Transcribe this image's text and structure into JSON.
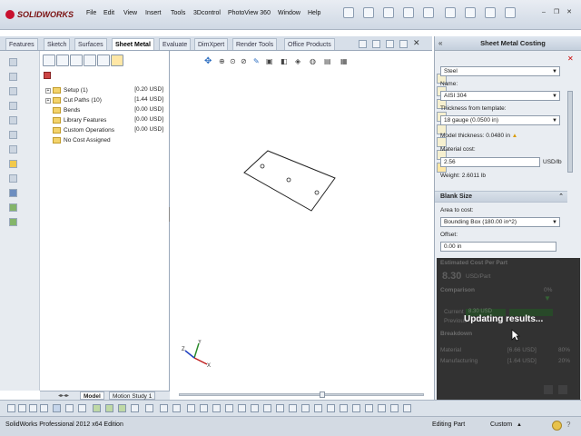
{
  "app": {
    "logo_text": "SOLIDWORKS",
    "menu": [
      "File",
      "Edit",
      "View",
      "Insert",
      "Tools",
      "3Dcontrol",
      "PhotoView 360",
      "Window",
      "Help"
    ]
  },
  "tabs": [
    "Features",
    "Sketch",
    "Surfaces",
    "Sheet Metal",
    "Evaluate",
    "DimXpert",
    "Render Tools",
    "Office Products"
  ],
  "active_tab": "Sheet Metal",
  "feature_tree": [
    {
      "label": "Setup (1)",
      "cost": "[0.20 USD]",
      "expandable": true
    },
    {
      "label": "Cut Paths (10)",
      "cost": "[1.44 USD]",
      "expandable": true
    },
    {
      "label": "Bends",
      "cost": "[0.00 USD]",
      "expandable": false
    },
    {
      "label": "Library Features",
      "cost": "[0.00 USD]",
      "expandable": false
    },
    {
      "label": "Custom Operations",
      "cost": "[0.00 USD]",
      "expandable": false
    },
    {
      "label": "No Cost Assigned",
      "cost": "",
      "expandable": false
    }
  ],
  "model_tabs": [
    "Model",
    "Motion Study 1"
  ],
  "pane": {
    "title": "Sheet Metal Costing",
    "material_class": "Steel",
    "name_label": "Name:",
    "name_value": "AISI 304",
    "thickness_label": "Thickness from template:",
    "thickness_value": "18 gauge (0.0500 in)",
    "model_thickness": "Model thickness: 0.0480 in",
    "material_cost_label": "Material cost:",
    "material_cost_value": "2.56",
    "material_cost_unit": "USD/lb",
    "weight": "Weight: 2.6011 lb",
    "blank_size_header": "Blank Size",
    "area_label": "Area to cost:",
    "area_value": "Bounding Box (180.00 in^2)",
    "offset_label": "Offset:",
    "offset_value": "0.00 in",
    "estimated_cost_header": "Estimated Cost Per Part",
    "estimated_cost_value": "8.30",
    "estimated_cost_unit": "USD/Part",
    "comparison": "Comparison",
    "comparison_pct": "0%",
    "current": "Current",
    "current_value": "8.30 USD",
    "previous": "Previous",
    "breakdown": "Breakdown",
    "material_row": "Material",
    "material_row_value": "[6.66 USD]",
    "material_row_pct": "80%",
    "manufacturing_row": "Manufacturing",
    "manufacturing_row_value": "[1.64 USD]",
    "manufacturing_row_pct": "20%",
    "overlay_text": "Updating results..."
  },
  "status": {
    "version": "SolidWorks Professional 2012 x64 Edition",
    "mode": "Editing Part",
    "units": "Custom"
  }
}
